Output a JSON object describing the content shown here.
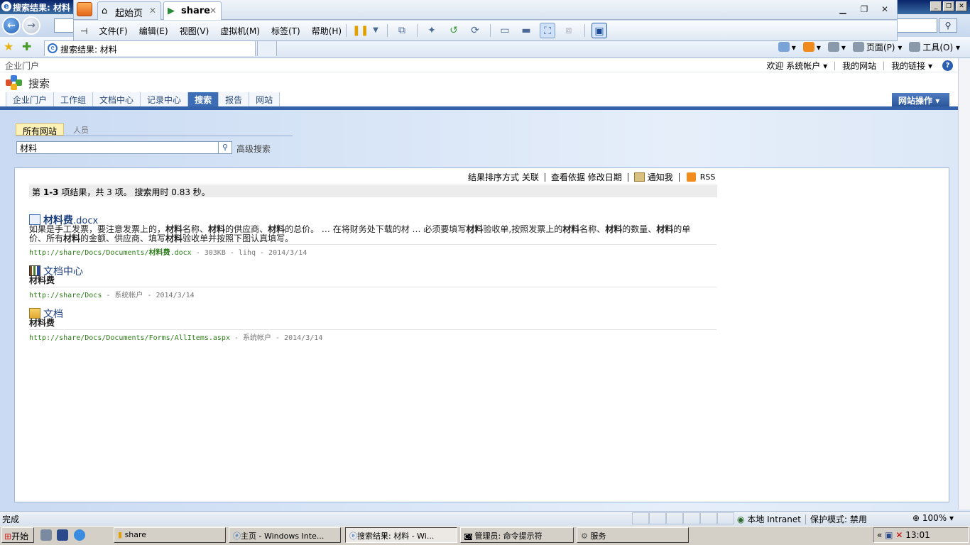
{
  "ie_window": {
    "title": "搜索结果: 材料",
    "tab_title": "搜索结果: 材料"
  },
  "vm": {
    "tabs": [
      {
        "label": "起始页",
        "icon": "home-icon"
      },
      {
        "label": "share",
        "icon": "vm-icon"
      }
    ],
    "close_glyph": "✕",
    "menu": [
      "文件(F)",
      "编辑(E)",
      "视图(V)",
      "虚拟机(M)",
      "标签(T)",
      "帮助(H)"
    ]
  },
  "ie_commandbar": {
    "page_label": "页面(P)",
    "tools_label": "工具(O)"
  },
  "sharepoint": {
    "site_label": "企业门户",
    "welcome": "欢迎",
    "user": "系统帐户",
    "my_site": "我的网站",
    "my_links": "我的链接",
    "title": "搜索",
    "tabs": [
      "企业门户",
      "工作组",
      "文档中心",
      "记录中心",
      "搜索",
      "报告",
      "网站"
    ],
    "active_tab": "搜索",
    "site_actions": "网站操作"
  },
  "search": {
    "scopes": [
      "所有网站",
      "人员"
    ],
    "query": "材料",
    "advanced": "高级搜索",
    "sort_label": "结果排序方式",
    "sort_relevance": "关联",
    "view_by": "查看依据",
    "modified_date": "修改日期",
    "alert_me": "通知我",
    "rss": "RSS",
    "stats_prefix": "第",
    "stats_range": "1-3",
    "stats_middle": "项结果，共 3 项。",
    "stats_time": "搜索用时 0.83 秒。"
  },
  "results": [
    {
      "title_bold": "材料费",
      "title_rest": ".docx",
      "icon": "word-doc-icon",
      "desc1": [
        "如果是手工发票，要注意发票上的，",
        "材料",
        "名称、",
        "材料",
        "的供应商、",
        "材料",
        "的总价。 … 在将财务处下载的材 … 必须要填写",
        "材料",
        "验收单,按照发票上的",
        "材料",
        "名称、",
        "材料",
        "的数量、",
        "材料",
        "的单"
      ],
      "desc2": [
        "价、所有",
        "材料",
        "的金额、供应商、填写",
        "材料",
        "验收单并按照下图认真填写。"
      ],
      "url_prefix": "http://share/Docs/Documents/",
      "url_bold": "材料费",
      "url_suffix": ".docx",
      "meta": " - 303KB - lihq - 2014/3/14"
    },
    {
      "title": "文档中心",
      "icon": "library-icon",
      "desc": "材料费",
      "url": "http://share/Docs",
      "meta": " - 系统帐户 - 2014/3/14"
    },
    {
      "title": "文档",
      "icon": "folder-icon",
      "desc": "材料费",
      "url": "http://share/Docs/Documents/Forms/AllItems.aspx",
      "meta": " - 系统帐户 - 2014/3/14"
    }
  ],
  "status_bar": {
    "text": "完成",
    "zone": "本地 Intranet",
    "protected": "保护模式: 禁用",
    "zoom": "100%"
  },
  "taskbar": {
    "start": "开始",
    "buttons": [
      "share",
      "主页 - Windows Inte...",
      "搜索结果: 材料 - Wi...",
      "管理员: 命令提示符",
      "服务"
    ],
    "clock": "13:01"
  },
  "colors": {
    "sp_blue": "#3362aa",
    "link_green": "#2e7d1b",
    "title_blue": "#1c3f7d"
  }
}
